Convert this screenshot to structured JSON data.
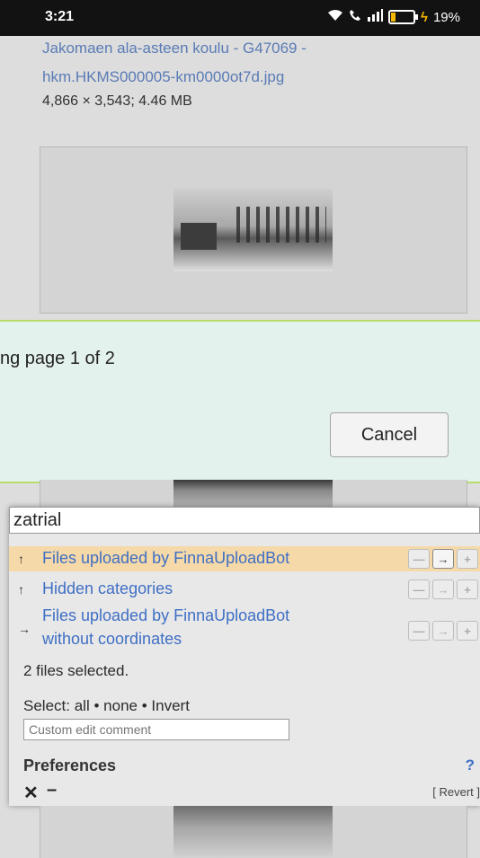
{
  "status_bar": {
    "time": "3:21",
    "battery": "19%"
  },
  "file": {
    "link_line1": "Jakomaen ala-asteen koulu - G47069 -",
    "link_line2": "hkm.HKMS000005-km0000ot7d.jpg",
    "meta": "4,866 × 3,543; 4.46 MB"
  },
  "dialog": {
    "message": "ng page 1 of 2",
    "cancel_label": "Cancel"
  },
  "hotcat": {
    "input_value": "zatrial",
    "categories": [
      {
        "arrow": "↑",
        "label": "Files uploaded by FinnaUploadBot"
      },
      {
        "arrow": "↑",
        "label": "Hidden categories"
      },
      {
        "arrow": "→",
        "label_line1": "Files uploaded by FinnaUploadBot",
        "label_line2": "without coordinates"
      }
    ],
    "button_glyphs": {
      "remove": "—",
      "move": "→",
      "add": "+"
    },
    "selected_text": "2 files selected.",
    "select_prefix": "Select:",
    "select_all": "all",
    "select_none": "none",
    "select_invert": "Invert",
    "separator": "•",
    "comment_placeholder": "Custom edit comment",
    "preferences": "Preferences",
    "help": "?",
    "close": "✕",
    "minimize": "–",
    "revert": "[ Revert ]"
  },
  "colors": {
    "link": "#3f6fc4",
    "highlight": "#f5d9a8",
    "dialog_bg": "#e4f2ee",
    "dialog_border": "#b8dc6a"
  }
}
